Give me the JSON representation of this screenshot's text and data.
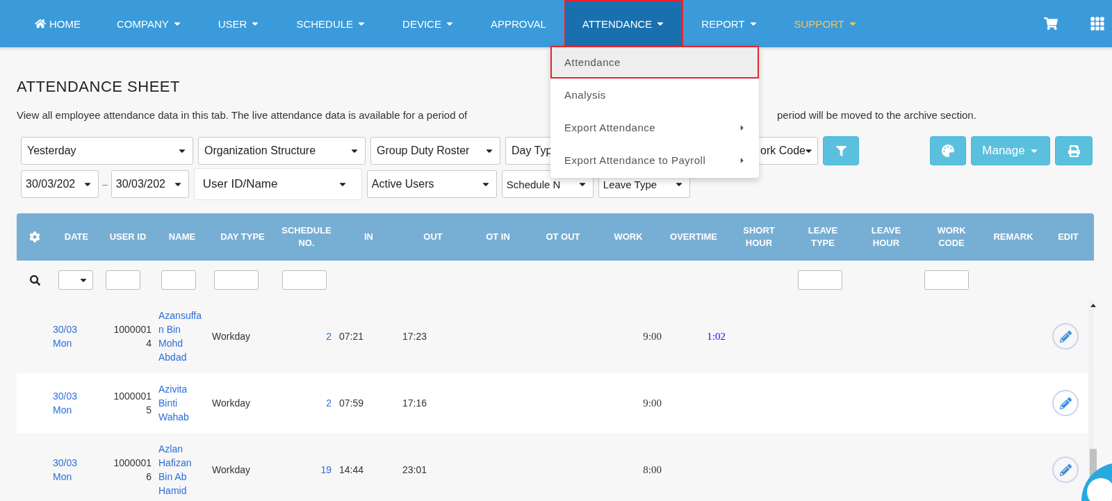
{
  "nav": {
    "items": [
      {
        "label": "HOME",
        "kind": "home",
        "selected": false,
        "highlighted": false
      },
      {
        "label": "COMPANY",
        "kind": "menu",
        "selected": false,
        "highlighted": false
      },
      {
        "label": "USER",
        "kind": "menu",
        "selected": false,
        "highlighted": false
      },
      {
        "label": "SCHEDULE",
        "kind": "menu",
        "selected": false,
        "highlighted": false
      },
      {
        "label": "DEVICE",
        "kind": "menu",
        "selected": false,
        "highlighted": false
      },
      {
        "label": "APPROVAL",
        "kind": "link",
        "selected": false,
        "highlighted": false
      },
      {
        "label": "ATTENDANCE",
        "kind": "menu",
        "selected": true,
        "highlighted": false
      },
      {
        "label": "REPORT",
        "kind": "menu",
        "selected": false,
        "highlighted": false
      },
      {
        "label": "SUPPORT",
        "kind": "menu",
        "selected": false,
        "highlighted": true
      }
    ]
  },
  "menu": {
    "items": [
      {
        "label": "Attendance",
        "selected": true,
        "submenu": false
      },
      {
        "label": "Analysis",
        "selected": false,
        "submenu": false
      },
      {
        "label": "Export Attendance",
        "selected": false,
        "submenu": true
      },
      {
        "label": "Export Attendance to Payroll",
        "selected": false,
        "submenu": true
      }
    ]
  },
  "page": {
    "title": "ATTENDANCE SHEET",
    "description_start": "View all employee attendance data in this tab. The live attendance data is available for a period of",
    "description_end": "period will be moved to the archive section."
  },
  "filters": {
    "row_1": [
      {
        "kind": "select",
        "value": "Yesterday"
      },
      {
        "kind": "select",
        "value": "Organization Structure"
      },
      {
        "kind": "select",
        "value": "Group Duty Roster"
      },
      {
        "kind": "select",
        "value": "Day Typ"
      },
      {
        "kind": "select",
        "value": "ork Code"
      },
      {
        "kind": "filter_button"
      }
    ],
    "row_2": [
      {
        "kind": "select",
        "value": "30/03/202"
      },
      {
        "kind": "separator",
        "value": "–"
      },
      {
        "kind": "select",
        "value": "30/03/202"
      },
      {
        "kind": "combo",
        "value": "User ID/Name"
      },
      {
        "kind": "select",
        "value": "Active Users"
      },
      {
        "kind": "select",
        "value": "Schedule N"
      },
      {
        "kind": "select",
        "value": "Leave Type"
      }
    ]
  },
  "toolbar": [
    {
      "kind": "palette"
    },
    {
      "kind": "manage",
      "label": "Manage"
    },
    {
      "kind": "print"
    }
  ],
  "table": {
    "columns": [
      {
        "label": "DATE",
        "kind": "select_filter"
      },
      {
        "label": "USER ID",
        "kind": "input_filter"
      },
      {
        "label": "NAME",
        "kind": "input_filter"
      },
      {
        "label": "DAY TYPE",
        "kind": "input_filter"
      },
      {
        "label": "SCHEDULE\nNO.",
        "kind": "input_filter"
      },
      {
        "label": "IN",
        "kind": "plain"
      },
      {
        "label": "OUT",
        "kind": "plain"
      },
      {
        "label": "OT IN",
        "kind": "plain"
      },
      {
        "label": "OT OUT",
        "kind": "plain"
      },
      {
        "label": "WORK",
        "kind": "plain"
      },
      {
        "label": "OVERTIME",
        "kind": "plain"
      },
      {
        "label": "SHORT\nHOUR",
        "kind": "plain"
      },
      {
        "label": "LEAVE\nTYPE",
        "kind": "input_filter"
      },
      {
        "label": "LEAVE\nHOUR",
        "kind": "plain"
      },
      {
        "label": "WORK\nCODE",
        "kind": "input_filter"
      },
      {
        "label": "REMARK",
        "kind": "plain"
      },
      {
        "label": "EDIT",
        "kind": "plain"
      }
    ],
    "rows": [
      {
        "date": "30/03 Mon",
        "user_id": "10000014",
        "name": "Azansuffan Bin Mohd Abdad",
        "day_type": "Workday",
        "schedule_no": "2",
        "in": "07:21",
        "out": "17:23",
        "work": "9:00",
        "overtime": "1:02"
      },
      {
        "date": "30/03 Mon",
        "user_id": "10000015",
        "name": "Azivita Binti Wahab",
        "day_type": "Workday",
        "schedule_no": "2",
        "in": "07:59",
        "out": "17:16",
        "work": "9:00"
      },
      {
        "date": "30/03 Mon",
        "user_id": "10000016",
        "name": "Azlan Hafizan Bin Ab Hamid",
        "day_type": "Workday",
        "schedule_no": "19",
        "in": "14:44",
        "out": "23:01",
        "work": "8:00"
      }
    ]
  }
}
